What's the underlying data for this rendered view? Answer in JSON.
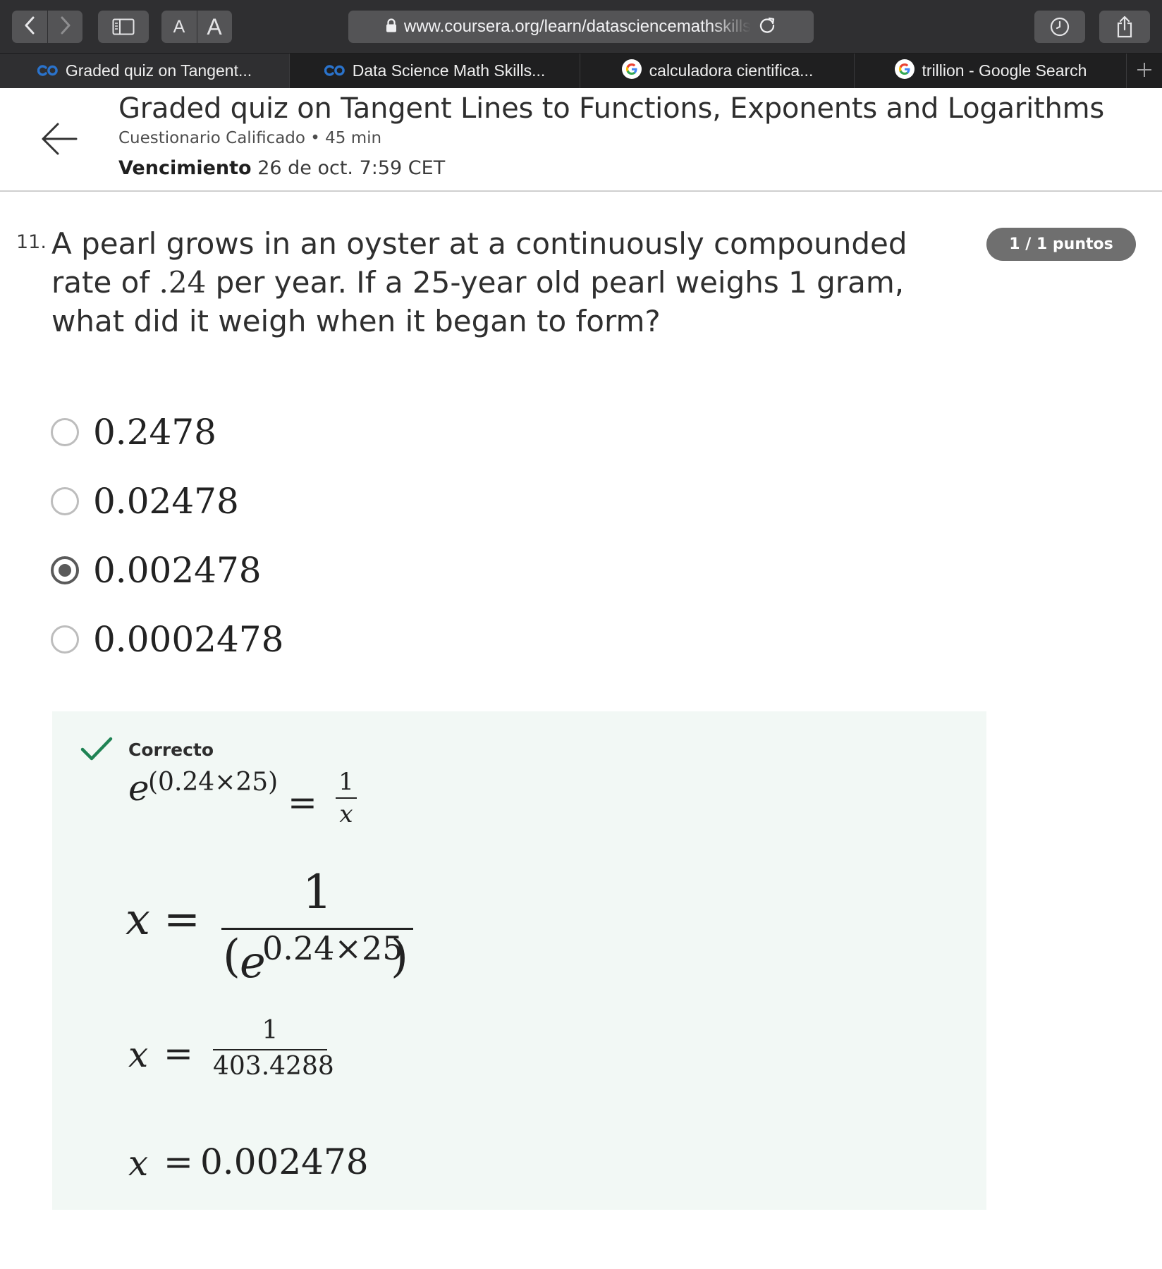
{
  "browser": {
    "url": "www.coursera.org/learn/datasciencemathskills",
    "tabs": [
      {
        "label": "Graded quiz on Tangent...",
        "icon": "coursera-icon",
        "active": true
      },
      {
        "label": "Data Science Math Skills...",
        "icon": "coursera-icon",
        "active": false
      },
      {
        "label": "calculadora cientifica...",
        "icon": "google-icon",
        "active": false
      },
      {
        "label": "trillion - Google Search",
        "icon": "google-icon",
        "active": false
      }
    ],
    "font_size_small": "A",
    "font_size_large": "A"
  },
  "header": {
    "title": "Graded quiz on Tangent Lines to Functions, Exponents and Logarithms",
    "meta": "Cuestionario Calificado • 45 min",
    "due_label": "Vencimiento",
    "due_value": "26 de oct. 7:59 CET"
  },
  "question": {
    "number": "11.",
    "text_before": "A pearl grows in an oyster at a continuously compounded rate of ",
    "rate": ".24",
    "text_after": " per year. If a 25-year old pearl weighs 1 gram, what did it weigh when it began to form?",
    "score": "1 / 1 puntos",
    "options": [
      {
        "label": "0.2478",
        "selected": false
      },
      {
        "label": "0.02478",
        "selected": false
      },
      {
        "label": "0.002478",
        "selected": true
      },
      {
        "label": "0.0002478",
        "selected": false
      }
    ]
  },
  "feedback": {
    "status": "Correcto",
    "eq1": {
      "base": "e",
      "exponent": "(0.24×25)",
      "equals": "=",
      "numerator": "1",
      "denominator": "x"
    },
    "eq2": {
      "lhs": "x",
      "equals": "=",
      "numerator": "1",
      "paren_left": "(",
      "base": "e",
      "exponent": "0.24×25",
      "paren_right": ")"
    },
    "eq3": {
      "lhs": "x",
      "equals": "=",
      "numerator": "1",
      "denominator": "403.4288"
    },
    "eq4": {
      "lhs": "x",
      "equals": "=",
      "rhs": "0.002478"
    }
  },
  "colors": {
    "toolbar_bg": "#2f2f31",
    "tabbar_bg": "#1f1f20",
    "badge_bg": "#6f6f6f",
    "feedback_bg": "#f2f8f5",
    "correct_green": "#1f8354",
    "coursera_blue": "#2a73cc"
  }
}
